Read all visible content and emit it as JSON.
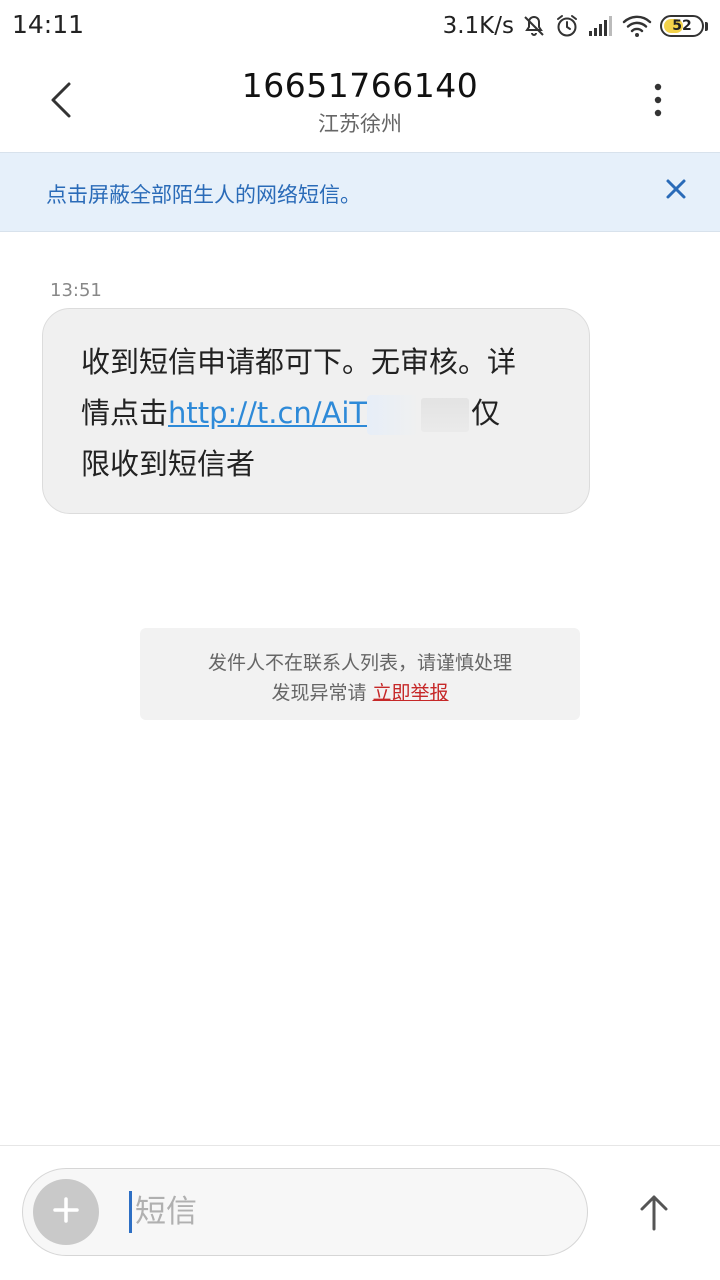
{
  "status_bar": {
    "time": "14:11",
    "network_speed": "3.1K/s",
    "battery_level": "52",
    "battery_fraction": 0.52,
    "icons": [
      "mute-icon",
      "alarm-icon",
      "signal-icon",
      "wifi-icon",
      "battery-icon"
    ]
  },
  "header": {
    "phone_number": "16651766140",
    "location": "江苏徐州",
    "back_icon": "chevron-left-icon",
    "more_icon": "more-vertical-icon"
  },
  "banner": {
    "text": "点击屏蔽全部陌生人的网络短信。",
    "close_icon": "close-icon",
    "color": "#2a6bb8"
  },
  "message": {
    "time": "13:51",
    "line1": "收到短信申请都可下。无审核。详",
    "line2_prefix": "情点击",
    "link": "http://t.cn/AiT",
    "line2_suffix": "仅",
    "line3": "限收到短信者",
    "link_color": "#2e8ad8"
  },
  "warning": {
    "line1": "发件人不在联系人列表，请谨慎处理",
    "line2_prefix": "发现异常请 ",
    "report_link": "立即举报",
    "report_color": "#c62828"
  },
  "compose": {
    "placeholder": "短信",
    "value": "",
    "add_icon": "plus-icon",
    "send_icon": "arrow-up-icon"
  }
}
